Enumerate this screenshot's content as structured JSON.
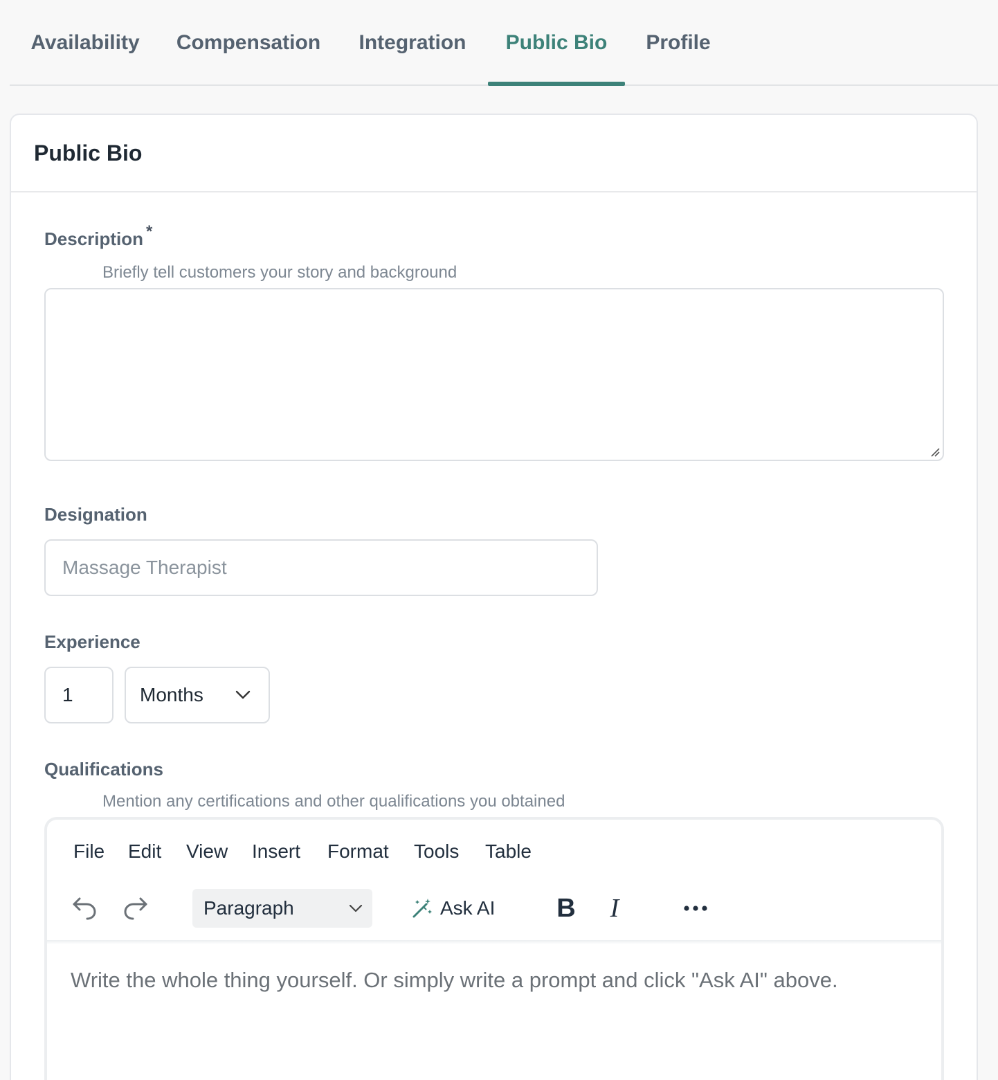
{
  "tabs": [
    {
      "label": "Availability",
      "active": false
    },
    {
      "label": "Compensation",
      "active": false
    },
    {
      "label": "Integration",
      "active": false
    },
    {
      "label": "Public Bio",
      "active": true
    },
    {
      "label": "Profile",
      "active": false
    }
  ],
  "card": {
    "title": "Public Bio"
  },
  "description": {
    "label": "Description",
    "required_mark": "*",
    "hint": "Briefly tell customers your story and background",
    "value": ""
  },
  "designation": {
    "label": "Designation",
    "placeholder": "Massage Therapist"
  },
  "experience": {
    "label": "Experience",
    "amount": "1",
    "unit": "Months"
  },
  "qualifications": {
    "label": "Qualifications",
    "hint": "Mention any certifications and other qualifications you obtained",
    "editor": {
      "menu": [
        "File",
        "Edit",
        "View",
        "Insert",
        "Format",
        "Tools",
        "Table"
      ],
      "block_format": "Paragraph",
      "ask_ai_label": "Ask AI",
      "placeholder": "Write the whole thing yourself. Or simply write a prompt and click \"Ask AI\" above."
    }
  },
  "colors": {
    "accent": "#3d8279",
    "text_dark": "#1f2933",
    "label": "#556270"
  }
}
